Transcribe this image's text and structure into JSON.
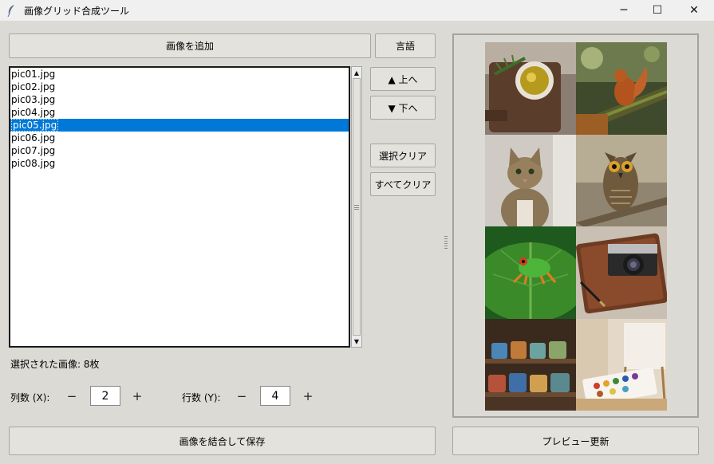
{
  "window": {
    "title": "画像グリッド合成ツール",
    "controls": {
      "minimize": "─",
      "maximize": "☐",
      "close": "✕"
    }
  },
  "toolbar": {
    "add_images_label": "画像を追加",
    "language_label": "言語"
  },
  "file_list": {
    "items": [
      "pic01.jpg",
      "pic02.jpg",
      "pic03.jpg",
      "pic04.jpg",
      "pic05.jpg",
      "pic06.jpg",
      "pic07.jpg",
      "pic08.jpg"
    ],
    "selected_index": 4
  },
  "side_buttons": {
    "move_up_label": "▲ 上へ",
    "move_down_label": "▼ 下へ",
    "clear_selection_label": "選択クリア",
    "clear_all_label": "すべてクリア"
  },
  "status": {
    "selected_count_text": "選択された画像: 8枚"
  },
  "grid_settings": {
    "columns_label": "列数 (X):",
    "columns_value": "2",
    "rows_label": "行数 (Y):",
    "rows_value": "4",
    "minus_symbol": "−",
    "plus_symbol": "+"
  },
  "actions": {
    "merge_save_label": "画像を結合して保存",
    "refresh_preview_label": "プレビュー更新"
  },
  "preview": {
    "tiles": [
      "olive-oil-board-image",
      "squirrel-image",
      "cat-image",
      "owl-image",
      "frog-image",
      "camera-notebook-image",
      "mugs-shelf-image",
      "watercolor-easel-image"
    ]
  },
  "colors": {
    "selection": "#0078d7",
    "background": "#dcdad5"
  }
}
